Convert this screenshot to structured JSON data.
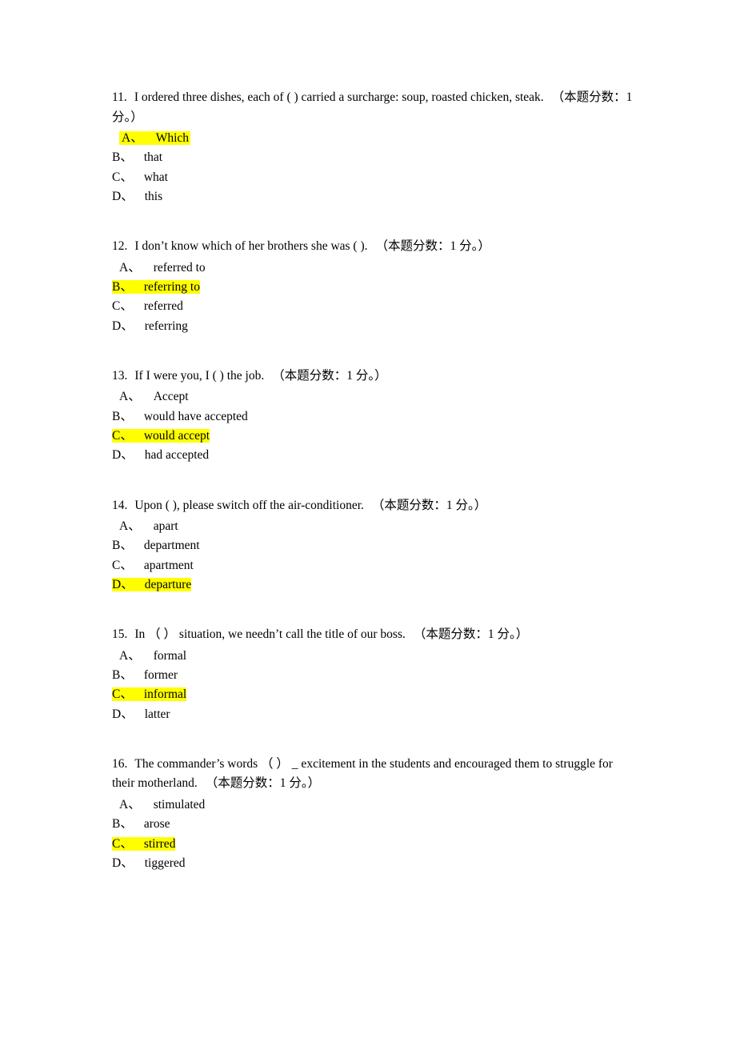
{
  "document": {
    "highlight_color": "#ffff00",
    "text_color": "#000000",
    "background_color": "#ffffff"
  },
  "questions": [
    {
      "id": "q11",
      "number": "11.",
      "stem": "I ordered three dishes, each of ( ) carried a surcharge: soup, roasted chicken, steak.",
      "score_note": "（本题分数：1 分。）",
      "options": [
        {
          "letter": "A、",
          "text": "Which",
          "highlighted": true
        },
        {
          "letter": "B、",
          "text": "that",
          "highlighted": false
        },
        {
          "letter": "C、",
          "text": "what",
          "highlighted": false
        },
        {
          "letter": "D、",
          "text": "this",
          "highlighted": false
        }
      ]
    },
    {
      "id": "q12",
      "number": "12.",
      "stem": "I don’t know which of her brothers she was ( ).",
      "score_note": "（本题分数：1 分。）",
      "options": [
        {
          "letter": "A、",
          "text": "referred to",
          "highlighted": false
        },
        {
          "letter": "B、",
          "text": "referring to",
          "highlighted": true
        },
        {
          "letter": "C、",
          "text": "referred",
          "highlighted": false
        },
        {
          "letter": "D、",
          "text": "referring",
          "highlighted": false
        }
      ]
    },
    {
      "id": "q13",
      "number": "13.",
      "stem": "If I were you, I ( ) the job.",
      "score_note": "（本题分数：1 分。）",
      "options": [
        {
          "letter": "A、",
          "text": "Accept",
          "highlighted": false
        },
        {
          "letter": "B、",
          "text": "would have accepted",
          "highlighted": false
        },
        {
          "letter": "C、",
          "text": "would accept",
          "highlighted": true
        },
        {
          "letter": "D、",
          "text": "had accepted",
          "highlighted": false
        }
      ]
    },
    {
      "id": "q14",
      "number": "14.",
      "stem": "Upon ( ), please switch off the air-conditioner.",
      "score_note": "（本题分数：1 分。）",
      "options": [
        {
          "letter": "A、",
          "text": "apart",
          "highlighted": false
        },
        {
          "letter": "B、",
          "text": "department",
          "highlighted": false
        },
        {
          "letter": "C、",
          "text": "apartment",
          "highlighted": false
        },
        {
          "letter": "D、",
          "text": "departure",
          "highlighted": true
        }
      ]
    },
    {
      "id": "q15",
      "number": "15.",
      "stem": "In （ ） situation, we needn’t call the title of our boss.",
      "score_note": "（本题分数：1 分。）",
      "options": [
        {
          "letter": "A、",
          "text": "formal",
          "highlighted": false
        },
        {
          "letter": "B、",
          "text": "former",
          "highlighted": false
        },
        {
          "letter": "C、",
          "text": "informal",
          "highlighted": true
        },
        {
          "letter": "D、",
          "text": "latter",
          "highlighted": false
        }
      ]
    },
    {
      "id": "q16",
      "number": "16.",
      "stem": "The commander’s words （ ） _ excitement in the students and encouraged them to struggle for their motherland.",
      "score_note": "（本题分数：1 分。）",
      "options": [
        {
          "letter": "A、",
          "text": "stimulated",
          "highlighted": false
        },
        {
          "letter": "B、",
          "text": "arose",
          "highlighted": false
        },
        {
          "letter": "C、",
          "text": "stirred",
          "highlighted": true
        },
        {
          "letter": "D、",
          "text": "tiggered",
          "highlighted": false
        }
      ]
    }
  ]
}
